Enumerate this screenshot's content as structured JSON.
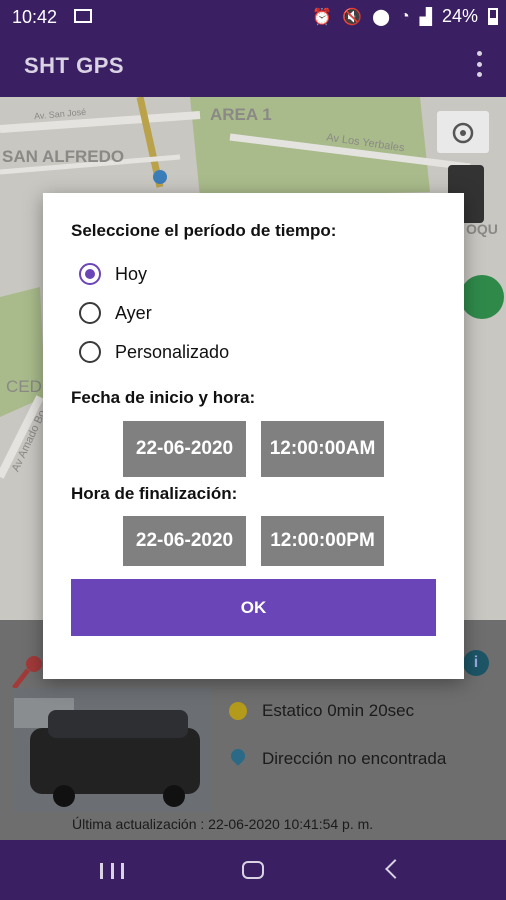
{
  "status_bar": {
    "time": "10:42",
    "battery": "24%"
  },
  "app_bar": {
    "title": "SHT GPS"
  },
  "map": {
    "labels": {
      "area": "AREA 1",
      "district": "SAN ALFREDO",
      "road1": "Av. San José",
      "road2": "Av Los Yerbales",
      "road3": "Av Amado Bo",
      "ced": "CED",
      "oqu": "OQU"
    }
  },
  "vehicle": {
    "status": "Estatico 0min 20sec",
    "address": "Dirección no encontrada",
    "last_update": "Última actualización : 22-06-2020 10:41:54 p. m."
  },
  "dialog": {
    "title": "Seleccione el período de tiempo:",
    "options": [
      {
        "label": "Hoy",
        "checked": true
      },
      {
        "label": "Ayer",
        "checked": false
      },
      {
        "label": "Personalizado",
        "checked": false
      }
    ],
    "start_label": "Fecha de inicio y hora:",
    "start_date": "22-06-2020",
    "start_time": "12:00:00AM",
    "end_label": "Hora de finalización:",
    "end_date": "22-06-2020",
    "end_time": "12:00:00PM",
    "ok_label": "OK"
  },
  "colors": {
    "primary": "#3a1f63",
    "accent": "#6a45b7",
    "field_bg": "#808080"
  }
}
